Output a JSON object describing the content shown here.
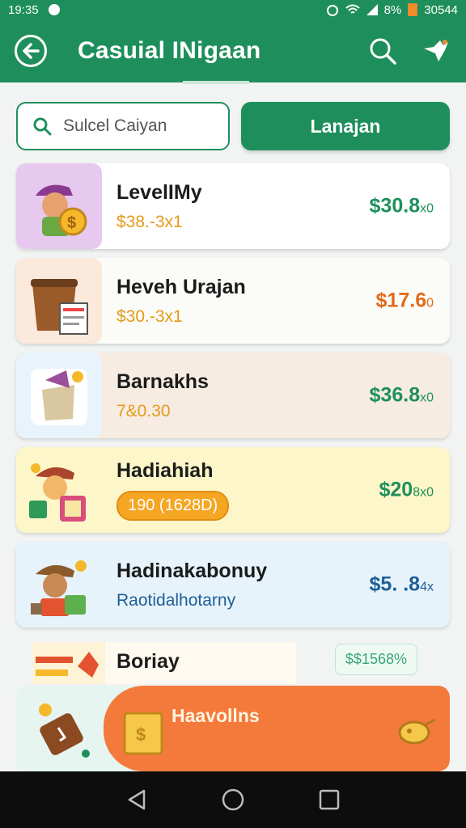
{
  "status_bar": {
    "time": "19:35",
    "battery_text": "8%",
    "right_text": "30544"
  },
  "app_bar": {
    "title": "Casuial INigaan",
    "back_icon": "arrow-left-icon",
    "search_icon": "search-icon",
    "action_icon": "bird-icon"
  },
  "search": {
    "placeholder": "Sulcel Caiyan",
    "button_label": "Lanajan"
  },
  "items": [
    {
      "name": "LevelIMy",
      "sub": "$38.-3x1",
      "sub_style": "plain",
      "price": "$30.8",
      "price_suffix": "x0",
      "price_color": "#1e8f5c",
      "bg": "#ffffff",
      "thumb_bg": "#e7c8ef"
    },
    {
      "name": "Heveh Urajan",
      "sub": "$30.-3x1",
      "sub_style": "plain",
      "price": "$17.6",
      "price_suffix": "0",
      "price_color": "#e46a1a",
      "bg": "#fbfbf7",
      "thumb_bg": "#fbe9dc"
    },
    {
      "name": "Barnakhs",
      "sub": "7&0.30",
      "sub_style": "plain",
      "price": "$36.8",
      "price_suffix": "x0",
      "price_color": "#1e8f5c",
      "bg": "#f7ece1",
      "thumb_bg": "#e8f3fb"
    },
    {
      "name": "Hadiahiah",
      "sub": "190 (1628D)",
      "sub_style": "pill",
      "price": "$20",
      "price_suffix": "8x0",
      "price_color": "#1e8f5c",
      "bg": "#fdf6c9",
      "thumb_bg": "#fdf6c9"
    },
    {
      "name": "Hadinakabonuy",
      "sub": "Raotidalhotarny",
      "sub_style": "blue",
      "price": "$5. .8",
      "price_suffix": "4x",
      "price_color": "#1f5e96",
      "bg": "#e6f3fb",
      "thumb_bg": "#e6f3fb"
    }
  ],
  "partial_item": {
    "name": "Boriay",
    "price": "$$1568%"
  },
  "banner": {
    "label": "Haavollns"
  },
  "nav": {
    "back_icon": "triangle-back-icon",
    "home_icon": "circle-home-icon",
    "recents_icon": "square-recents-icon"
  }
}
